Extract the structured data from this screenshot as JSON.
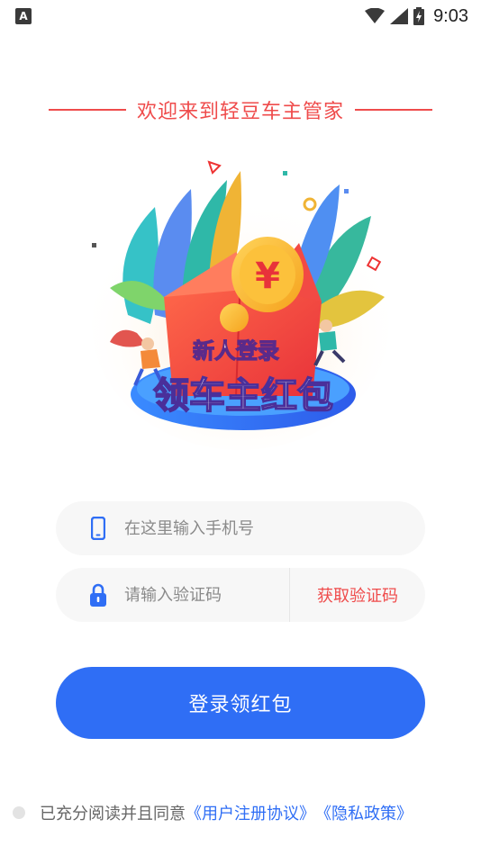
{
  "status_bar": {
    "time": "9:03",
    "app_indicator": "A"
  },
  "welcome": {
    "title": "欢迎来到轻豆车主管家"
  },
  "hero": {
    "subtitle": "新人登录",
    "title": "领车主红包",
    "coin_symbol": "¥"
  },
  "form": {
    "phone_placeholder": "在这里输入手机号",
    "code_placeholder": "请输入验证码",
    "get_code_label": "获取验证码"
  },
  "login_button": {
    "label": "登录领红包"
  },
  "agreement": {
    "prefix": "已充分阅读并且同意",
    "user_agreement": "《用户注册协议》",
    "privacy_policy": "《隐私政策》"
  },
  "colors": {
    "accent_red": "#ef4b4b",
    "primary_blue": "#2f6ef5"
  }
}
